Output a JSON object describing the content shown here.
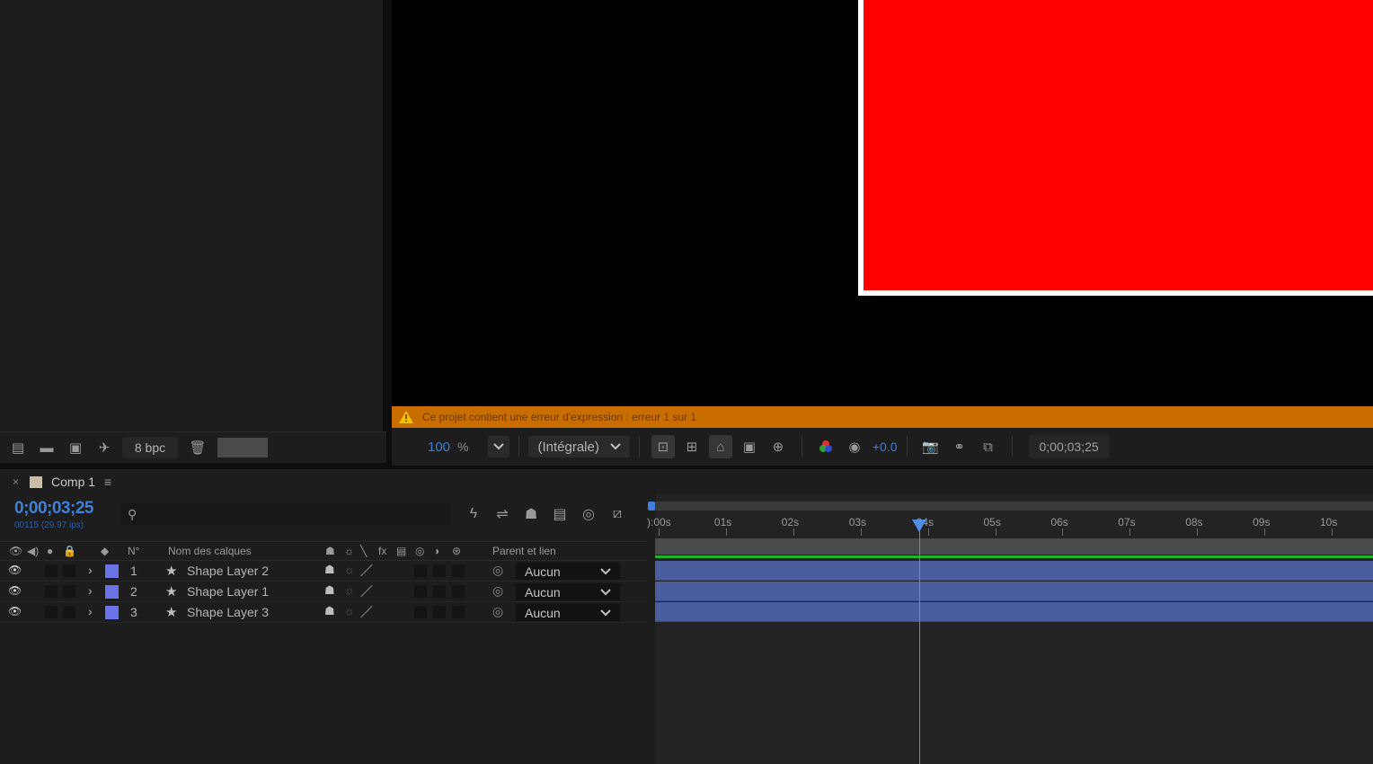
{
  "project_panel": {
    "bpc_label": "8 bpc",
    "icons": [
      "interpret-footage-icon",
      "new-folder-icon",
      "new-composition-icon",
      "render-queue-icon",
      "trash-icon"
    ]
  },
  "viewer": {
    "warning_text": "Ce projet contient une erreur d'expression : erreur 1 sur 1",
    "toolbar": {
      "zoom_value": "100",
      "zoom_unit": "%",
      "resolution": "(Intégrale)",
      "exposure": "+0.0",
      "current_time": "0;00;03;25"
    },
    "colors": {
      "shape_fill": "#ff0000",
      "warning_bar": "#c96d00"
    }
  },
  "timeline": {
    "comp_tab": "Comp 1",
    "current_time": "0;00;03;25",
    "frame_info": "00115 (29.97 ips)",
    "columns": {
      "number": "N°",
      "layer_name": "Nom des calques",
      "parent": "Parent et lien"
    },
    "ruler": [
      "):00s",
      "01s",
      "02s",
      "03s",
      "04s",
      "05s",
      "06s",
      "07s",
      "08s",
      "09s",
      "10s"
    ],
    "layers": [
      {
        "number": "1",
        "name": "Shape Layer 2",
        "parent": "Aucun"
      },
      {
        "number": "2",
        "name": "Shape Layer 1",
        "parent": "Aucun"
      },
      {
        "number": "3",
        "name": "Shape Layer 3",
        "parent": "Aucun"
      }
    ],
    "playhead_seconds": 3.87
  }
}
